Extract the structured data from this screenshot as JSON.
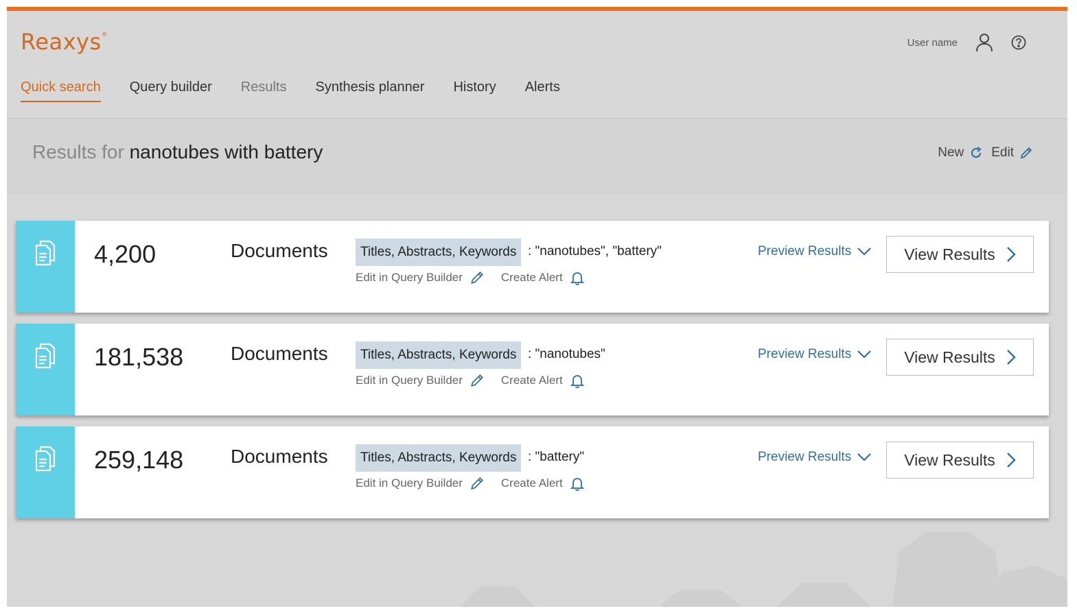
{
  "app": {
    "logo": "Reaxys",
    "logo_mark": "®",
    "user_name": "User name",
    "accent_color": "#e9711c",
    "stripe_color": "#5fd0e6"
  },
  "nav": {
    "tabs": [
      {
        "label": "Quick search",
        "state": "active"
      },
      {
        "label": "Query builder",
        "state": "normal"
      },
      {
        "label": "Results",
        "state": "muted"
      },
      {
        "label": "Synthesis planner",
        "state": "normal"
      },
      {
        "label": "History",
        "state": "normal"
      },
      {
        "label": "Alerts",
        "state": "normal"
      }
    ]
  },
  "results_bar": {
    "prefix": "Results for",
    "query": "nanotubes with battery",
    "new_label": "New",
    "edit_label": "Edit"
  },
  "cards": [
    {
      "count": "4,200",
      "type": "Documents",
      "field": "Titles, Abstracts, Keywords",
      "terms": ": \"nanotubes\", \"battery\"",
      "edit_label": "Edit in Query Builder",
      "alert_label": "Create Alert",
      "preview_label": "Preview Results",
      "view_label": "View Results"
    },
    {
      "count": "181,538",
      "type": "Documents",
      "field": "Titles, Abstracts, Keywords",
      "terms": ": \"nanotubes\"",
      "edit_label": "Edit in Query Builder",
      "alert_label": "Create Alert",
      "preview_label": "Preview Results",
      "view_label": "View Results"
    },
    {
      "count": "259,148",
      "type": "Documents",
      "field": "Titles, Abstracts, Keywords",
      "terms": ": \"battery\"",
      "edit_label": "Edit in Query Builder",
      "alert_label": "Create Alert",
      "preview_label": "Preview Results",
      "view_label": "View Results"
    }
  ],
  "icons": {
    "user": "user-icon",
    "help": "help-icon",
    "refresh": "refresh-icon",
    "pencil": "pencil-icon",
    "document": "documents-icon",
    "bell": "bell-icon",
    "chevron_down": "chevron-down-icon",
    "chevron_right": "chevron-right-icon"
  }
}
